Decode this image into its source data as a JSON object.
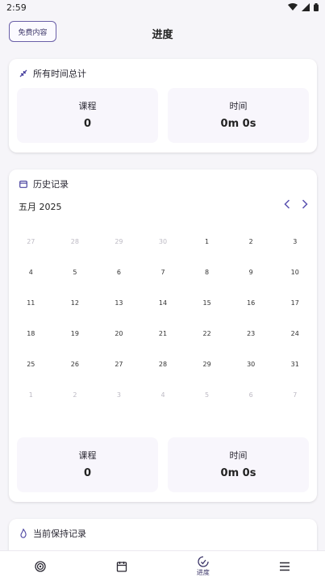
{
  "status": {
    "time": "2:59"
  },
  "header": {
    "free_button": "免费内容",
    "title": "进度"
  },
  "summary": {
    "title": "所有时间总计",
    "stats": [
      {
        "label": "课程",
        "value": "0"
      },
      {
        "label": "时间",
        "value": "0m 0s"
      }
    ]
  },
  "history": {
    "title": "历史记录",
    "month": "五月 2025",
    "weeks": [
      [
        "27",
        "28",
        "29",
        "30",
        "1",
        "2",
        "3"
      ],
      [
        "4",
        "5",
        "6",
        "7",
        "8",
        "9",
        "10"
      ],
      [
        "11",
        "12",
        "13",
        "14",
        "15",
        "16",
        "17"
      ],
      [
        "18",
        "19",
        "20",
        "21",
        "22",
        "23",
        "24"
      ],
      [
        "25",
        "26",
        "27",
        "28",
        "29",
        "30",
        "31"
      ],
      [
        "1",
        "2",
        "3",
        "4",
        "5",
        "6",
        "7"
      ]
    ],
    "stats": [
      {
        "label": "课程",
        "value": "0"
      },
      {
        "label": "时间",
        "value": "0m 0s"
      }
    ]
  },
  "streak": {
    "title": "当前保持记录"
  },
  "bottom_nav": [
    {
      "label": "",
      "icon": "target-icon"
    },
    {
      "label": "",
      "icon": "calendar-icon"
    },
    {
      "label": "进度",
      "icon": "progress-icon"
    },
    {
      "label": "",
      "icon": "menu-icon"
    }
  ],
  "colors": {
    "accent": "#6a5fa8",
    "card_bg": "#ffffff",
    "stat_bg": "#f8f6fc"
  }
}
